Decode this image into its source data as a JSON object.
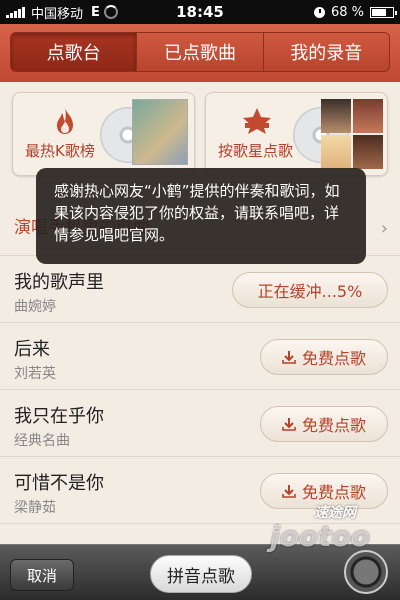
{
  "status_bar": {
    "carrier": "中国移动",
    "network": "E",
    "time": "18:45",
    "battery": "68 %",
    "battery_level": 0.68
  },
  "tabs": [
    {
      "label": "点歌台",
      "active": true
    },
    {
      "label": "已点歌曲",
      "active": false
    },
    {
      "label": "我的录音",
      "active": false
    }
  ],
  "categories": [
    {
      "label": "最热K歌榜",
      "icon": "flame-icon"
    },
    {
      "label": "按歌星点歌",
      "icon": "star-icon"
    }
  ],
  "section": {
    "label": "演唱手机里的歌曲"
  },
  "toast": {
    "message": "感谢热心网友“小鹤”提供的伴奏和歌词，如果该内容侵犯了你的权益，请联系唱吧，详情参见唱吧官网。"
  },
  "songs": [
    {
      "title": "我的歌声里",
      "artist": "曲婉婷",
      "action": "正在缓冲...5%",
      "buffering": true,
      "progress": 0.05
    },
    {
      "title": "后来",
      "artist": "刘若英",
      "action": "免费点歌",
      "buffering": false
    },
    {
      "title": "我只在乎你",
      "artist": "经典名曲",
      "action": "免费点歌",
      "buffering": false
    },
    {
      "title": "可惜不是你",
      "artist": "梁静茹",
      "action": "免费点歌",
      "buffering": false
    }
  ],
  "bottom_bar": {
    "cancel_label": "取消",
    "pinyin_label": "拼音点歌"
  },
  "watermark": {
    "text": "jootoo",
    "cn_text": "速途网"
  },
  "colors": {
    "accent": "#c0452e",
    "topbar": "#c9563c"
  }
}
